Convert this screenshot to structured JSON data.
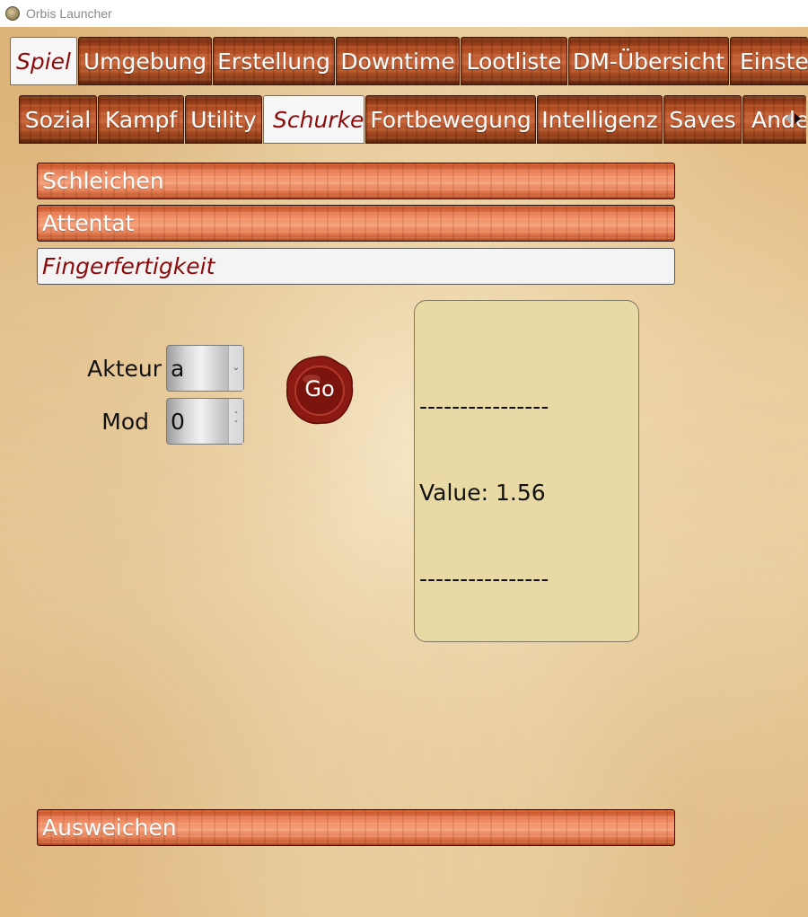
{
  "window": {
    "title": "Orbis Launcher"
  },
  "main_tabs": [
    {
      "label": "Spiel"
    },
    {
      "label": "Umgebung"
    },
    {
      "label": "Erstellung"
    },
    {
      "label": "Downtime"
    },
    {
      "label": "Lootliste"
    },
    {
      "label": "DM-Übersicht"
    },
    {
      "label": "Einstel"
    }
  ],
  "sub_tabs": [
    {
      "label": "Sozial"
    },
    {
      "label": "Kampf"
    },
    {
      "label": "Utility"
    },
    {
      "label": "Schurke"
    },
    {
      "label": "Fortbewegung"
    },
    {
      "label": "Intelligenz"
    },
    {
      "label": "Saves"
    },
    {
      "label": "Ande"
    }
  ],
  "sections": [
    {
      "label": "Schleichen"
    },
    {
      "label": "Attentat"
    },
    {
      "label": "Fingerfertigkeit"
    }
  ],
  "form": {
    "actor_label": "Akteur",
    "actor_value": "a",
    "mod_label": "Mod",
    "mod_value": "0",
    "go_label": "Go"
  },
  "output": {
    "line1": "----------------",
    "line2": "Value: 1.56",
    "line3": "----------------"
  },
  "bottom_section": {
    "label": "Ausweichen"
  },
  "colors": {
    "active_text": "#8b0a0a",
    "output_bg": "#e8d9a5",
    "seal": "#8b1a12"
  }
}
